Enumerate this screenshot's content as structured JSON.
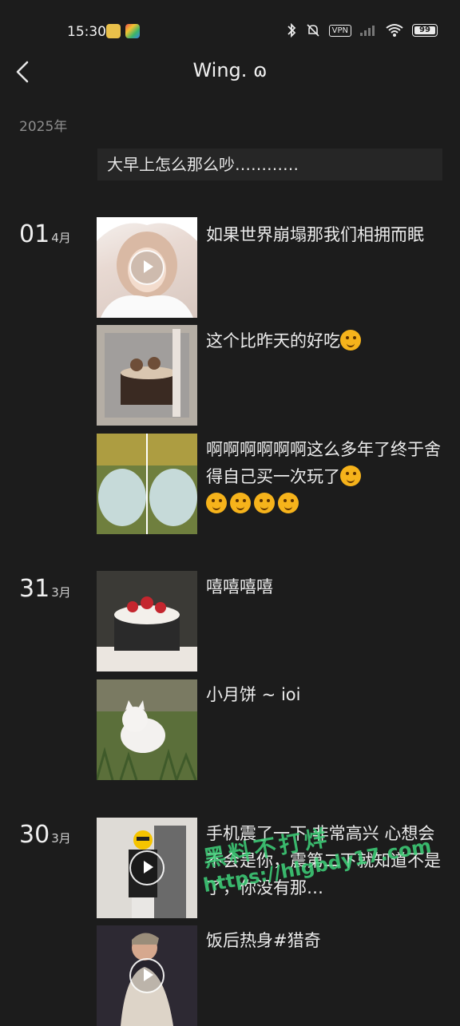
{
  "status": {
    "time": "15:30",
    "vpn": "VPN",
    "battery": "99"
  },
  "header": {
    "title": "Wing. ɷ"
  },
  "year_label": "2025年",
  "previous_entry": "大早上怎么那么吵…………",
  "days": [
    {
      "day": "01",
      "month": "4月",
      "entries": [
        {
          "text": "如果世界崩塌那我们相拥而眠",
          "media": "video"
        },
        {
          "text": "这个比昨天的好吃",
          "media": "image"
        },
        {
          "text": "啊啊啊啊啊啊这么多年了终于舍得自己买一次玩了",
          "media": "image"
        }
      ]
    },
    {
      "day": "31",
      "month": "3月",
      "entries": [
        {
          "text": "嘻嘻嘻嘻",
          "media": "image"
        },
        {
          "text": "小月饼 ~ ioi",
          "media": "image"
        }
      ]
    },
    {
      "day": "30",
      "month": "3月",
      "entries": [
        {
          "text": "手机震了一下 非常高兴 心想会不会是你，震第二下就知道不是了，你没有那…",
          "media": "video"
        },
        {
          "text": "饭后热身#猎奇",
          "media": "video"
        }
      ]
    }
  ],
  "watermark": {
    "line1": "黑料不打烊",
    "line2": "https://hlgbdy17.com"
  },
  "colors": {
    "background": "#1c1c1c",
    "watermark": "#3fd37a",
    "emoji": "#f6b31b"
  }
}
